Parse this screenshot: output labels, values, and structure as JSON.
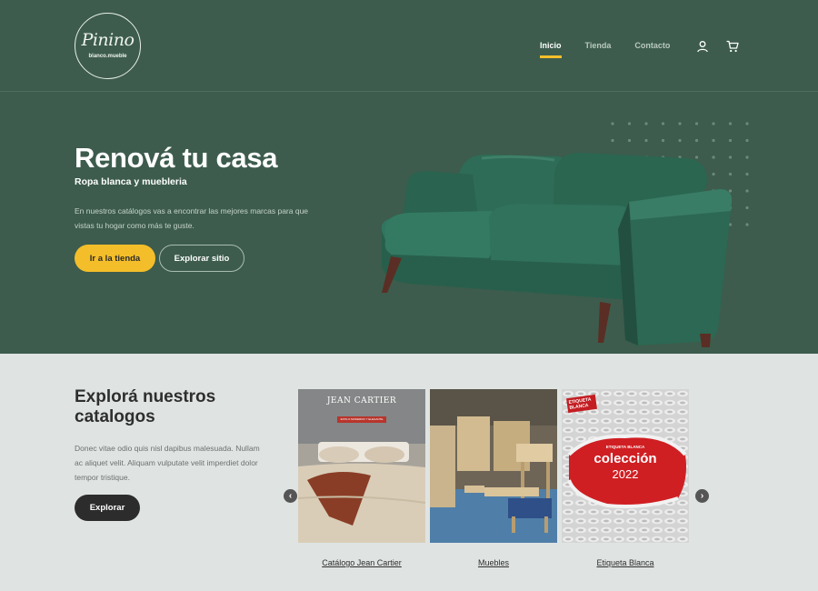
{
  "brand": {
    "name": "Pinino",
    "tagline": "blanco.mueble"
  },
  "nav": {
    "items": [
      {
        "label": "Inicio",
        "active": true
      },
      {
        "label": "Tienda",
        "active": false
      },
      {
        "label": "Contacto",
        "active": false
      }
    ],
    "icons": [
      "user-icon",
      "cart-icon"
    ]
  },
  "hero": {
    "title": "Renová tu casa",
    "subtitle": "Ropa blanca y muebleria",
    "description": "En nuestros catálogos vas a encontrar las mejores marcas para que vistas tu hogar como más te guste.",
    "primary_button": "Ir a la tienda",
    "secondary_button": "Explorar sitio"
  },
  "catalogs": {
    "title": "Explorá nuestros catalogos",
    "description": "Donec vitae odio quis nisl dapibus malesuada. Nullam ac aliquet velit. Aliquam vulputate velit imperdiet dolor tempor tristique.",
    "button": "Explorar",
    "prev_icon": "chevron-left-icon",
    "next_icon": "chevron-right-icon",
    "cards": [
      {
        "label": "Catálogo Jean Cartier",
        "brand": "JEAN CARTIER",
        "brand_sub": "ESTILO MODERNO Y ELEGANTE"
      },
      {
        "label": "Muebles"
      },
      {
        "label": "Etiqueta Blanca",
        "tag": "ETIQUETA BLANCA",
        "headline_small": "ETIQUETA BLANCA",
        "headline": "colección",
        "year": "2022"
      }
    ]
  },
  "colors": {
    "green": "#3d5c4d",
    "accent": "#f4be2a",
    "light_bg": "#dfe4e2",
    "dark": "#2c2c2c",
    "sofa": "#2d6a55"
  }
}
